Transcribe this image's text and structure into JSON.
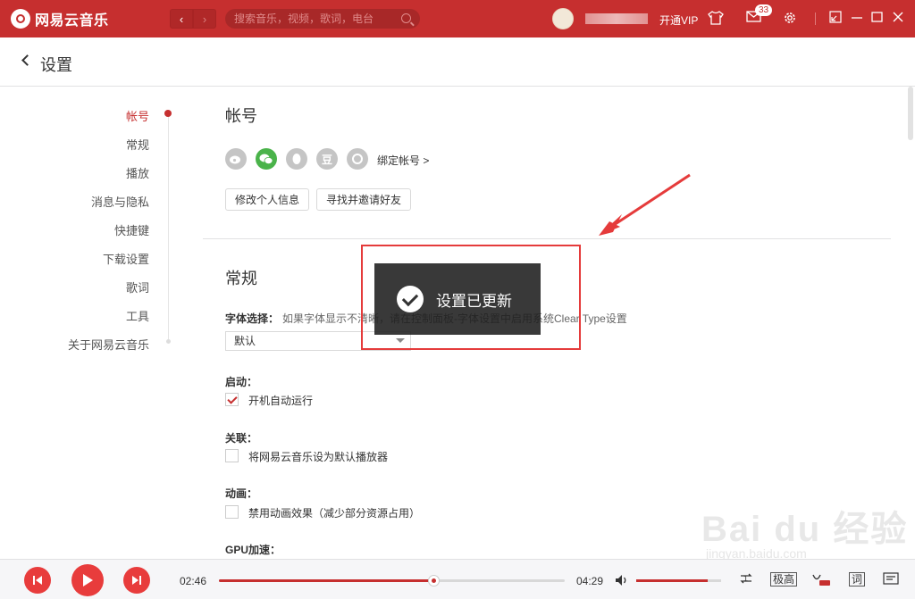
{
  "app": {
    "title": "网易云音乐",
    "brand_color": "#c62f2f"
  },
  "topbar": {
    "search_placeholder": "搜索音乐，视频，歌词，电台",
    "vip_label": "开通VIP",
    "message_count": "33"
  },
  "page": {
    "title": "设置"
  },
  "sidebar": {
    "items": [
      {
        "label": "帐号",
        "active": true
      },
      {
        "label": "常规"
      },
      {
        "label": "播放"
      },
      {
        "label": "消息与隐私"
      },
      {
        "label": "快捷键"
      },
      {
        "label": "下载设置"
      },
      {
        "label": "歌词"
      },
      {
        "label": "工具"
      },
      {
        "label": "关于网易云音乐"
      }
    ]
  },
  "account": {
    "title": "帐号",
    "icons": [
      "weibo-icon",
      "wechat-icon",
      "qq-icon",
      "douban-icon",
      "netease-icon"
    ],
    "douban_glyph": "豆",
    "bind_link": "绑定帐号 >",
    "edit_profile_button": "修改个人信息",
    "invite_button": "寻找并邀请好友"
  },
  "general": {
    "title": "常规",
    "font_label": "字体选择：",
    "font_hint": "如果字体显示不清晰，请在控制面板-字体设置中启用系统Clear Type设置",
    "font_value": "默认",
    "startup_label": "启动：",
    "startup_option": "开机自动运行",
    "startup_checked": true,
    "assoc_label": "关联：",
    "assoc_option": "将网易云音乐设为默认播放器",
    "assoc_checked": false,
    "anim_label": "动画：",
    "anim_option": "禁用动画效果（减少部分资源占用）",
    "anim_checked": false,
    "gpu_label": "GPU加速："
  },
  "toast": {
    "text": "设置已更新"
  },
  "player": {
    "current_time": "02:46",
    "total_time": "04:29",
    "progress": 0.62,
    "volume": 0.84,
    "quality_label": "极高",
    "lyrics_label": "词",
    "loop_label": "1"
  },
  "watermark": {
    "text": "Bai du 经验",
    "sub": "jingyan.baidu.com"
  }
}
